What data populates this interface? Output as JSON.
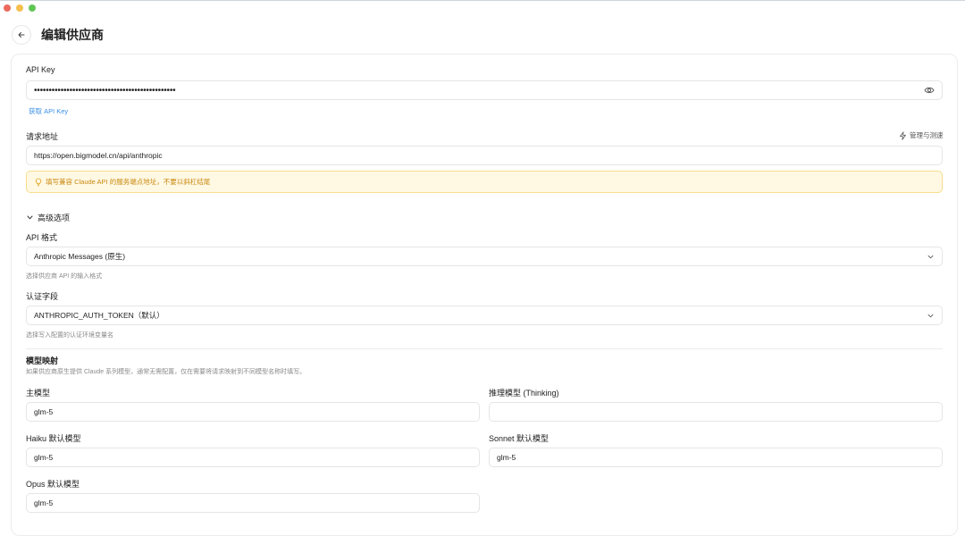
{
  "window": {
    "controls": [
      "close",
      "minimize",
      "maximize"
    ]
  },
  "header": {
    "title": "编辑供应商",
    "back_icon": "arrow-left-icon"
  },
  "api_key": {
    "label": "API Key",
    "value": "••••••••••••••••••••••••••••••••••••••••••••••••",
    "get_link": "获取 API Key"
  },
  "endpoint": {
    "label": "请求地址",
    "manage_button": "管理与测速",
    "value": "https://open.bigmodel.cn/api/anthropic",
    "warning": "填写兼容 Claude API 的服务端点地址，不要以斜杠结尾"
  },
  "advanced": {
    "toggle_label": "高级选项",
    "api_format": {
      "label": "API 格式",
      "selected": "Anthropic Messages (原生)",
      "hint": "选择供应商 API 的输入格式"
    },
    "auth_field": {
      "label": "认证字段",
      "selected": "ANTHROPIC_AUTH_TOKEN（默认）",
      "hint": "选择写入配置的认证环境变量名"
    }
  },
  "model_mapping": {
    "title": "模型映射",
    "description": "如果供应商原生提供 Claude 系列模型，通常无需配置，仅在需要将请求映射到不同模型名称时填写。",
    "main_model": {
      "label": "主模型",
      "value": "glm-5"
    },
    "reasoning_model": {
      "label": "推理模型 (Thinking)",
      "value": ""
    },
    "haiku_model": {
      "label": "Haiku 默认模型",
      "value": "glm-5"
    },
    "sonnet_model": {
      "label": "Sonnet 默认模型",
      "value": "glm-5"
    },
    "opus_model": {
      "label": "Opus 默认模型",
      "value": "glm-5"
    }
  },
  "colors": {
    "accent_link": "#3a8ee6",
    "warning_bg": "#fff8e3",
    "warning_text": "#c98a12"
  }
}
